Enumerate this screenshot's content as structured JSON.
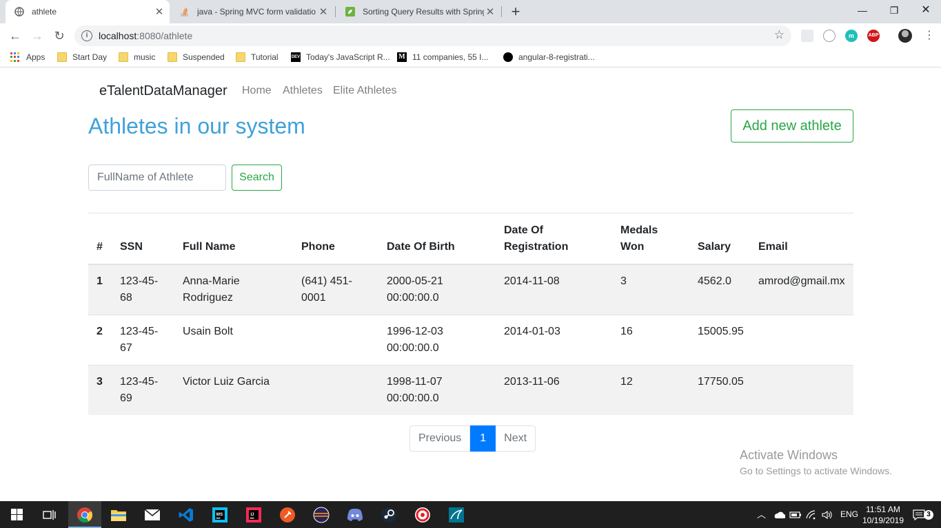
{
  "browser": {
    "tabs": [
      {
        "title": "athlete",
        "active": true
      },
      {
        "title": "java - Spring MVC form validatio",
        "active": false
      },
      {
        "title": "Sorting Query Results with Spring",
        "active": false
      }
    ],
    "url_host": "localhost",
    "url_rest": ":8080/athlete",
    "bookmarks": [
      {
        "label": "Apps",
        "icon": "apps-grid-icon"
      },
      {
        "label": "Start Day",
        "icon": "folder-icon"
      },
      {
        "label": "music",
        "icon": "folder-icon"
      },
      {
        "label": "Suspended",
        "icon": "folder-icon"
      },
      {
        "label": "Tutorial",
        "icon": "folder-icon"
      },
      {
        "label": "Today's JavaScript R...",
        "icon": "dev-icon"
      },
      {
        "label": "11 companies, 55 I...",
        "icon": "medium-icon"
      },
      {
        "label": "angular-8-registrati...",
        "icon": "github-icon"
      }
    ],
    "ext_m": "m",
    "ext_abp": "ABP"
  },
  "app": {
    "brand": "eTalentDataManager",
    "nav": [
      "Home",
      "Athletes",
      "Elite Athletes"
    ],
    "heading": "Athletes in our system",
    "add_button": "Add new athlete",
    "search_placeholder": "FullName of Athlete",
    "search_button": "Search"
  },
  "table": {
    "headers": [
      "#",
      "SSN",
      "Full Name",
      "Phone",
      "Date Of Birth",
      "Date Of Registration",
      "Medals Won",
      "Salary",
      "Email"
    ],
    "rows": [
      [
        "1",
        "123-45-68",
        "Anna-Marie Rodriguez",
        "(641) 451-0001",
        "2000-05-21 00:00:00.0",
        "2014-11-08",
        "3",
        "4562.0",
        "amrod@gmail.mx"
      ],
      [
        "2",
        "123-45-67",
        "Usain Bolt",
        "",
        "1996-12-03 00:00:00.0",
        "2014-01-03",
        "16",
        "15005.95",
        ""
      ],
      [
        "3",
        "123-45-69",
        "Victor Luiz Garcia",
        "",
        "1998-11-07 00:00:00.0",
        "2013-11-06",
        "12",
        "17750.05",
        ""
      ]
    ]
  },
  "pagination": {
    "previous": "Previous",
    "current": "1",
    "next": "Next"
  },
  "watermark": {
    "line1": "Activate Windows",
    "line2": "Go to Settings to activate Windows."
  },
  "taskbar": {
    "language": "ENG",
    "time": "11:51 AM",
    "date": "10/19/2019",
    "notifications": "3"
  }
}
